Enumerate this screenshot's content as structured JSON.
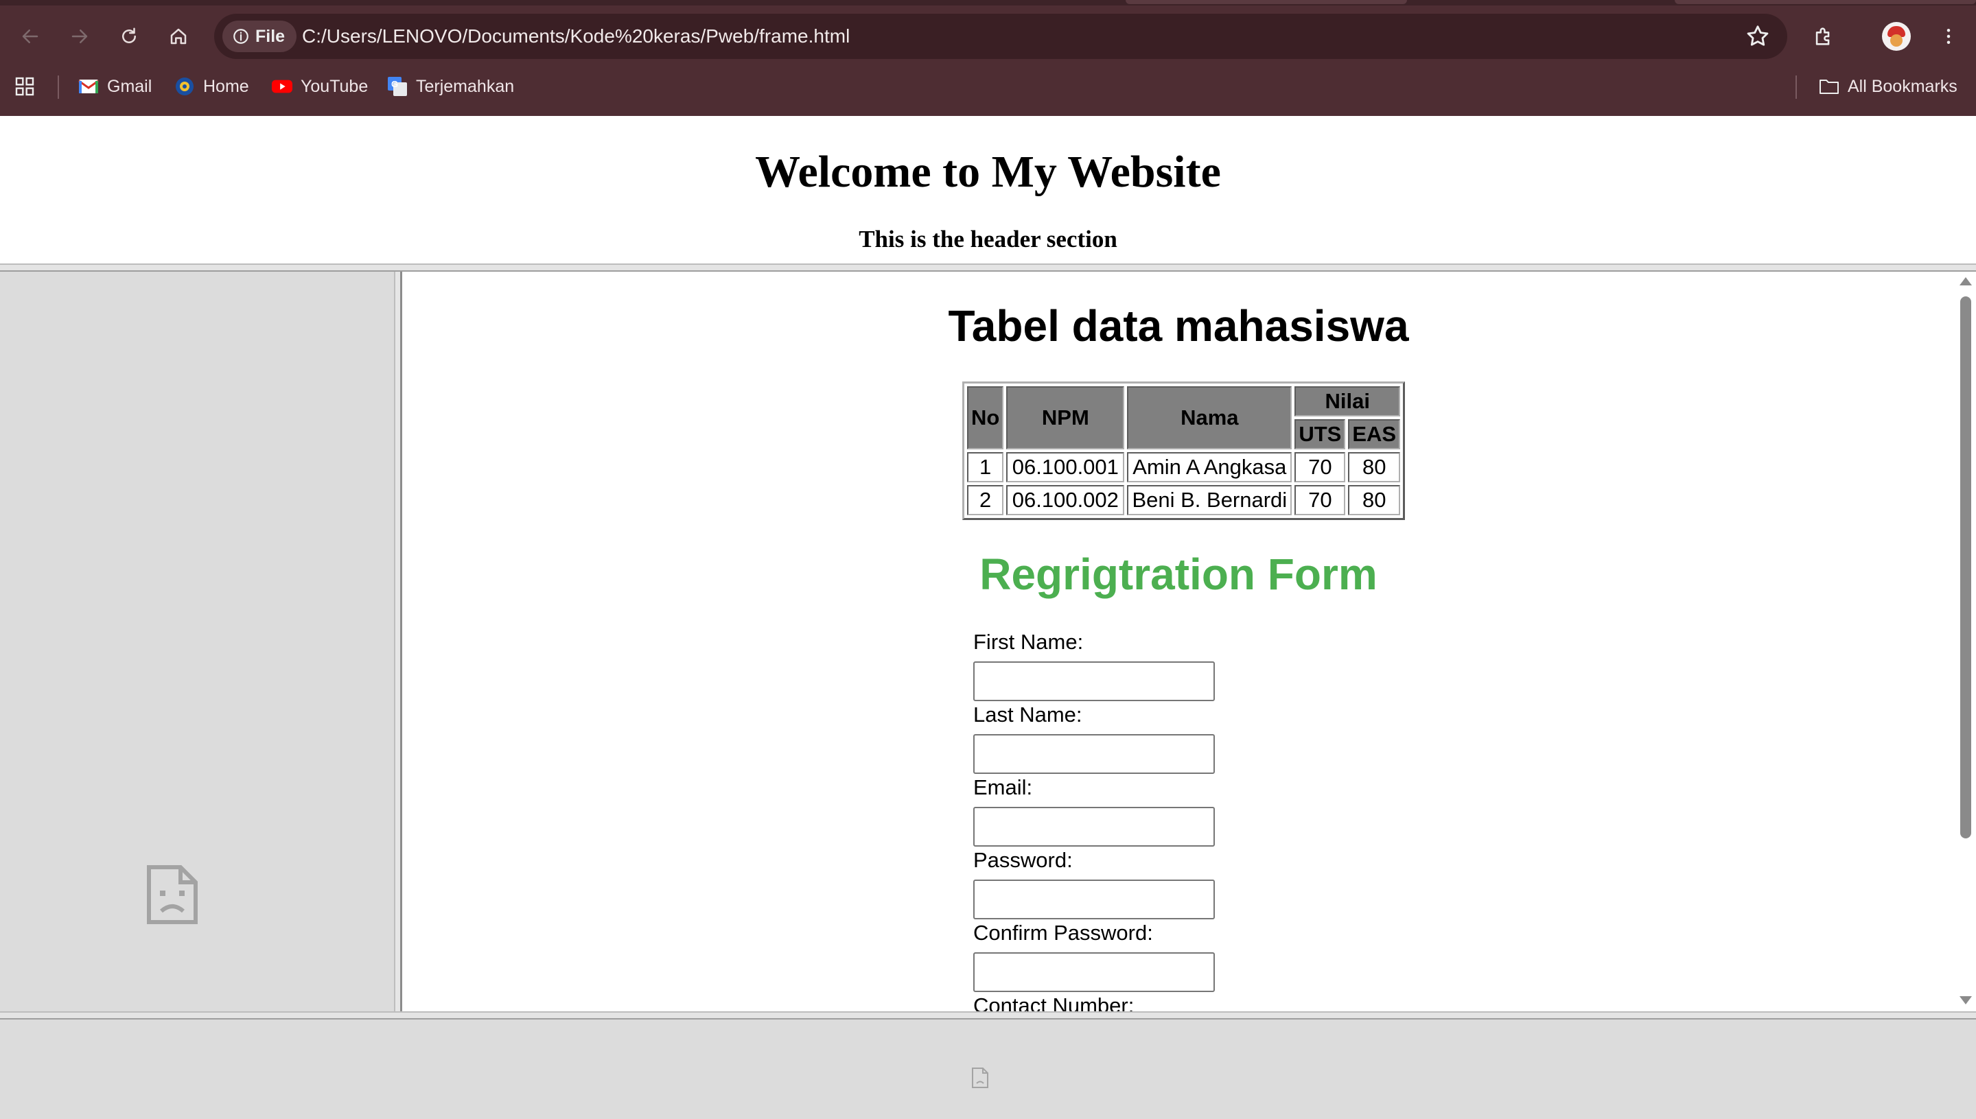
{
  "browser": {
    "site_chip_label": "File",
    "url": "C:/Users/LENOVO/Documents/Kode%20keras/Pweb/frame.html",
    "bookmarks": [
      {
        "label": "Gmail",
        "icon": "gmail-icon"
      },
      {
        "label": "Home",
        "icon": "home-site-icon"
      },
      {
        "label": "YouTube",
        "icon": "youtube-icon"
      },
      {
        "label": "Terjemahkan",
        "icon": "translate-icon"
      }
    ],
    "all_bookmarks_label": "All Bookmarks"
  },
  "header": {
    "title": "Welcome to My Website",
    "subtitle": "This is the header section"
  },
  "main": {
    "table_title": "Tabel data mahasiswa",
    "table": {
      "headers": {
        "no": "No",
        "npm": "NPM",
        "nama": "Nama",
        "nilai": "Nilai",
        "uts": "UTS",
        "eas": "EAS"
      },
      "rows": [
        {
          "no": "1",
          "npm": "06.100.001",
          "nama": "Amin A Angkasa",
          "uts": "70",
          "eas": "80"
        },
        {
          "no": "2",
          "npm": "06.100.002",
          "nama": "Beni B. Bernardi",
          "uts": "70",
          "eas": "80"
        }
      ]
    },
    "form_title": "Regrigtration Form",
    "form_fields": [
      {
        "label": "First Name:",
        "value": ""
      },
      {
        "label": "Last Name:",
        "value": ""
      },
      {
        "label": "Email:",
        "value": ""
      },
      {
        "label": "Password:",
        "value": ""
      },
      {
        "label": "Confirm Password:",
        "value": ""
      },
      {
        "label": "Contact Number:",
        "value": ""
      }
    ]
  },
  "colors": {
    "chrome_bg": "#4e2d33",
    "omnibox_bg": "#3a1f24",
    "form_title": "#4caf50",
    "table_header_bg": "#808080"
  }
}
